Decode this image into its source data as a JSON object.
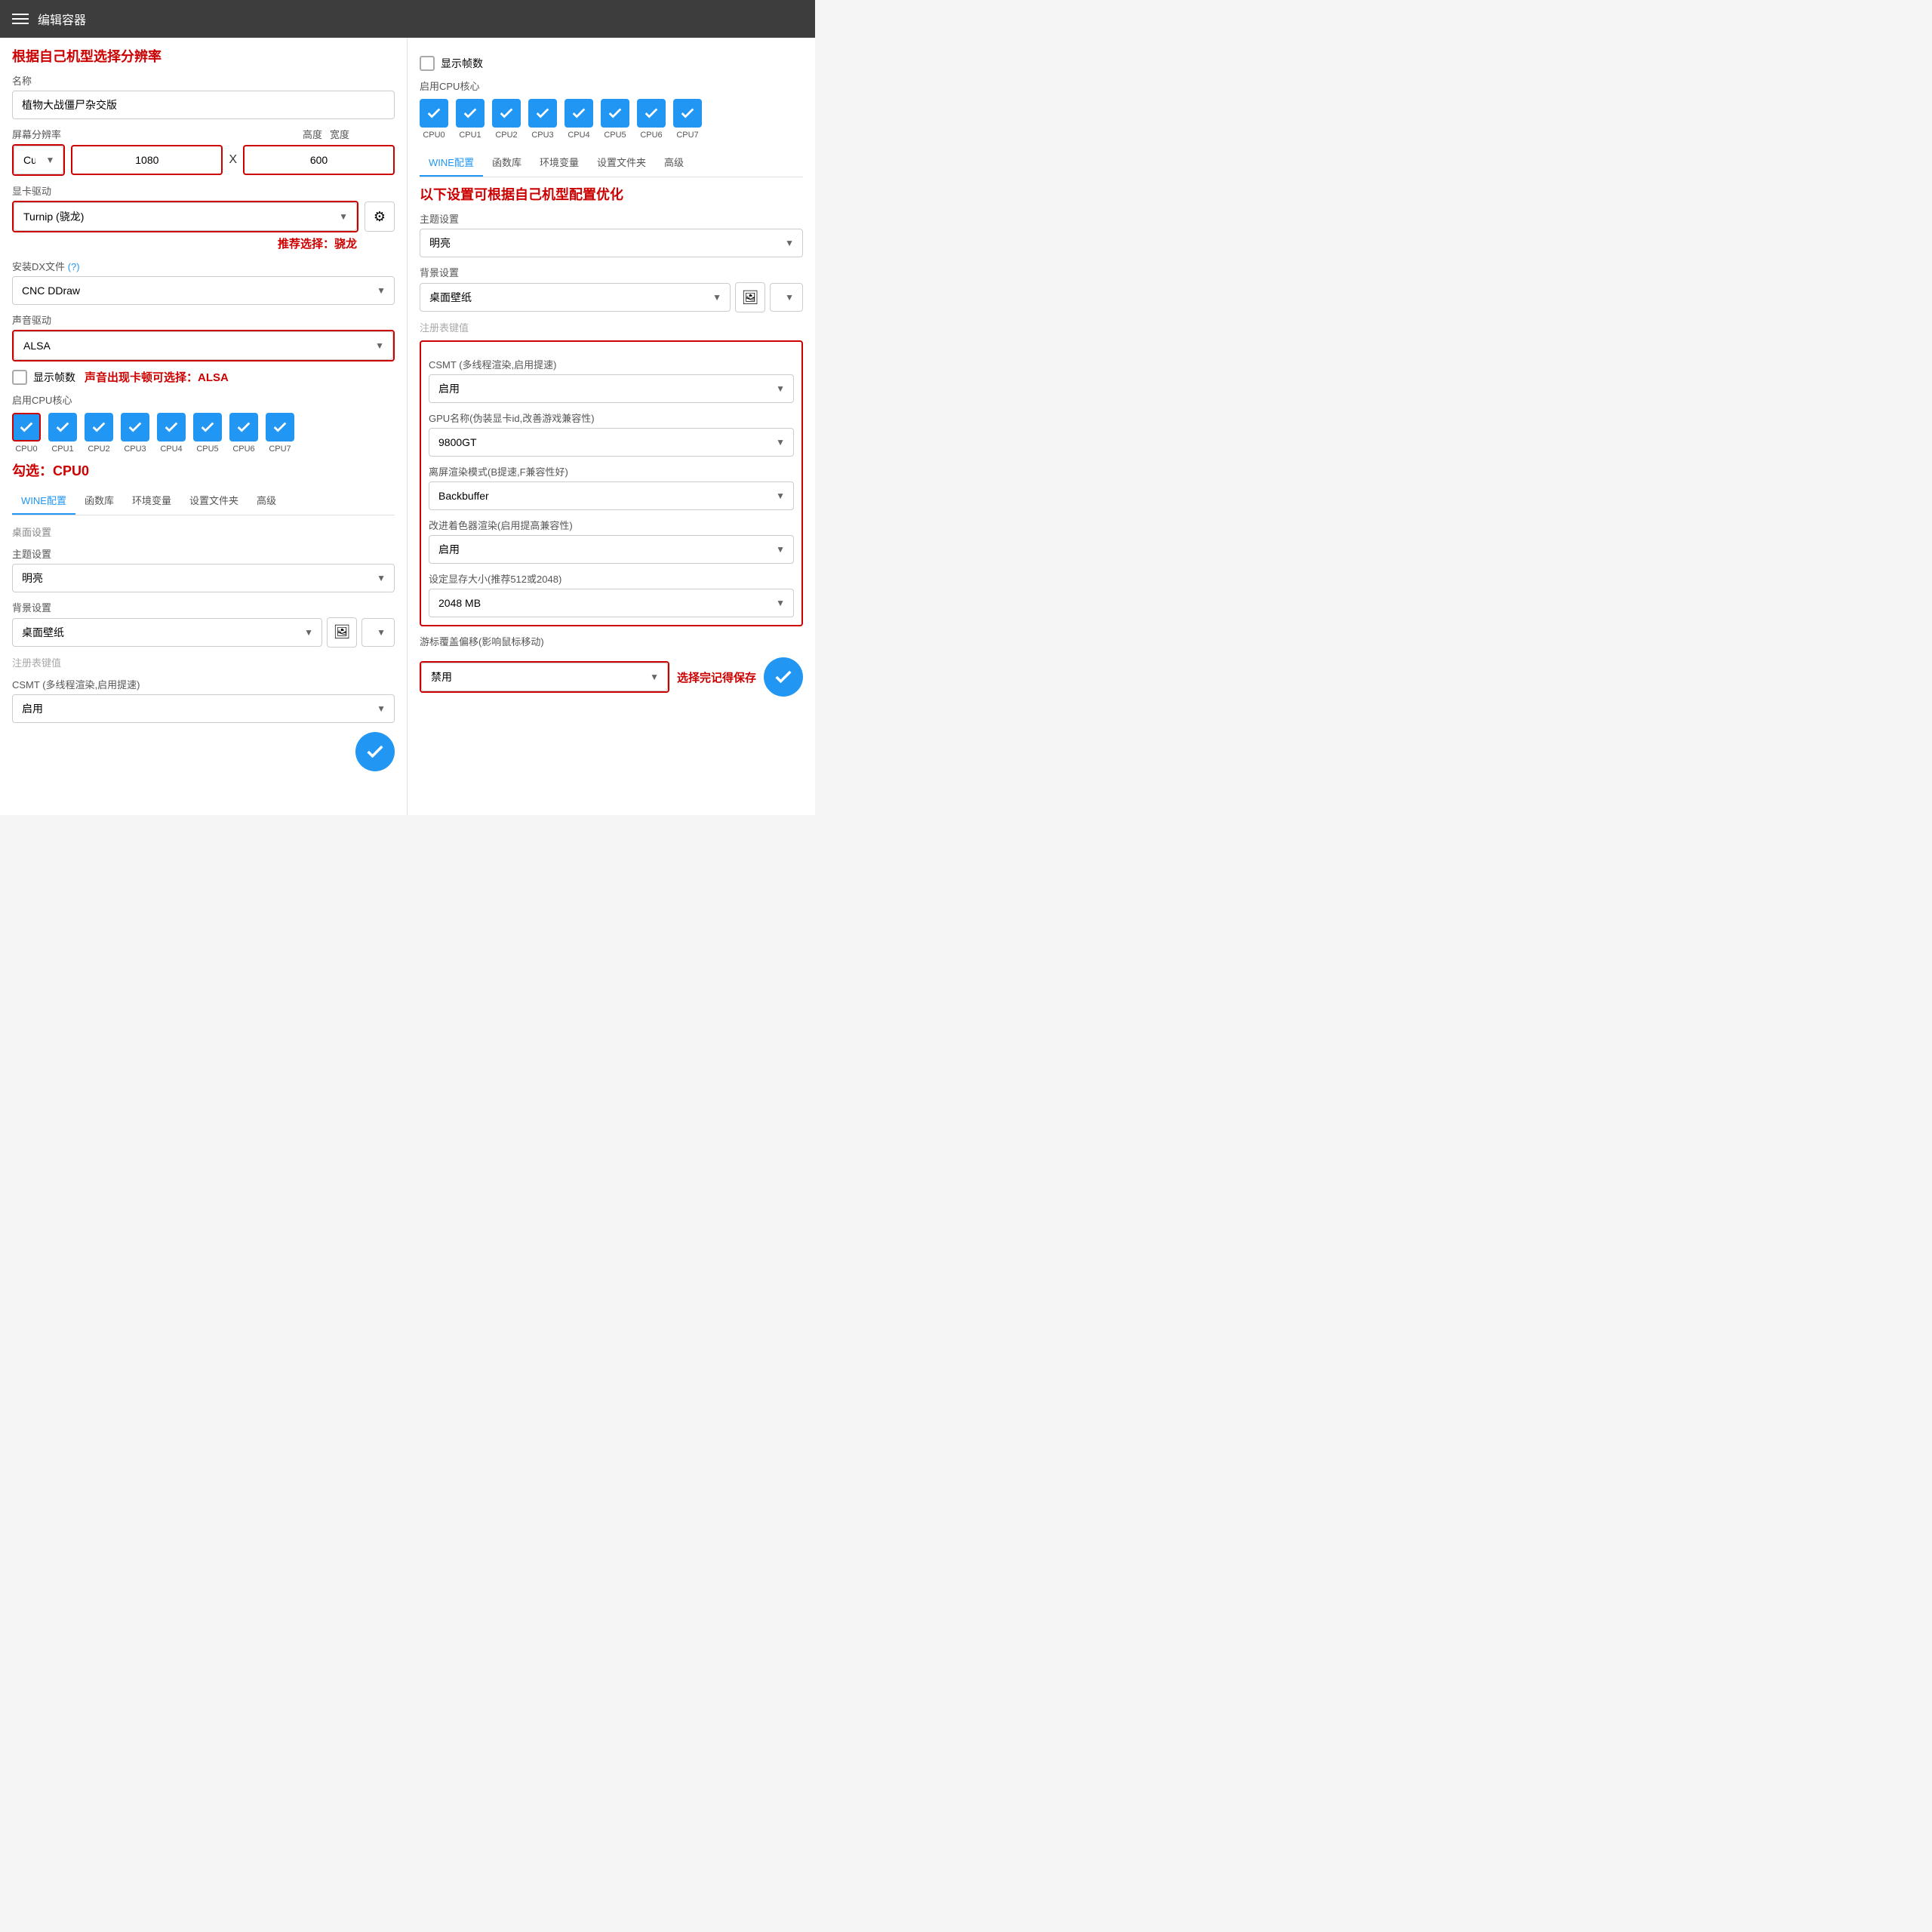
{
  "header": {
    "title": "编辑容器"
  },
  "annotations": {
    "title_annotation": "根据自己机型选择分辨率",
    "gpu_annotation": "推荐选择：骁龙",
    "audio_annotation": "声音出现卡顿可选择：ALSA",
    "cpu_annotation": "勾选：CPU0",
    "wine_annotation": "以下设置可根据自己机型配置优化",
    "save_annotation": "选择完记得保存"
  },
  "left": {
    "name_label": "名称",
    "name_value": "植物大战僵尸杂交版",
    "resolution_label": "屏幕分辨率",
    "width_label": "宽度",
    "height_label": "高度",
    "resolution_option": "Custom",
    "width_value": "1080",
    "height_value": "600",
    "gpu_label": "显卡驱动",
    "gpu_option": "Turnip (骁龙)",
    "dx_label": "安装DX文件",
    "dx_option": "CNC DDraw",
    "audio_label": "声音驱动",
    "audio_option": "ALSA",
    "show_fps_label": "显示帧数",
    "cpu_label": "启用CPU核心",
    "cpu_cores": [
      "CPU0",
      "CPU1",
      "CPU2",
      "CPU3",
      "CPU4",
      "CPU5",
      "CPU6",
      "CPU7"
    ],
    "tabs": [
      "WINE配置",
      "函数库",
      "环境变量",
      "设置文件夹",
      "高级"
    ],
    "active_tab": "WINE配置",
    "desktop_section": "桌面设置",
    "theme_label": "主题设置",
    "theme_option": "明亮",
    "bg_label": "背景设置",
    "bg_option": "桌面壁纸",
    "reg_label": "注册表键值",
    "csmt_label": "CSMT (多线程渲染,启用提速)",
    "csmt_option": "启用",
    "save_btn_visible": true
  },
  "right": {
    "show_fps_label": "显示帧数",
    "cpu_label": "启用CPU核心",
    "cpu_cores": [
      "CPU0",
      "CPU1",
      "CPU2",
      "CPU3",
      "CPU4",
      "CPU5",
      "CPU6",
      "CPU7"
    ],
    "tabs": [
      "WINE配置",
      "函数库",
      "环境变量",
      "设置文件夹",
      "高级"
    ],
    "active_tab": "WINE配置",
    "wine_annotation": "以下设置可根据自己机型配置优化",
    "theme_label": "主题设置",
    "theme_option": "明亮",
    "bg_label": "背景设置",
    "bg_option": "桌面壁纸",
    "reg_label": "注册表键值",
    "csmt_section_label": "CSMT (多线程渲染,启用提速)",
    "csmt_option": "启用",
    "gpu_name_label": "GPU名称(伪装显卡id,改善游戏兼容性)",
    "gpu_name_option": "9800GT",
    "offscreen_label": "离屏渲染模式(B提速,F兼容性好)",
    "offscreen_option": "Backbuffer",
    "shader_label": "改进着色器渲染(启用提高兼容性)",
    "shader_option": "启用",
    "vram_label": "设定显存大小(推荐512或2048)",
    "vram_option": "2048 MB",
    "cursor_label": "游标覆盖偏移(影响鼠标移动)",
    "cursor_option": "禁用",
    "save_annotation": "选择完记得保存"
  }
}
